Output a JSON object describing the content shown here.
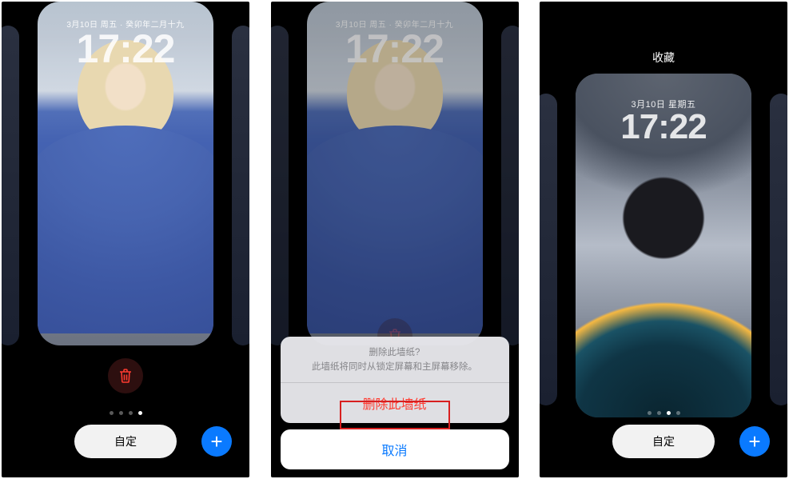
{
  "lock_screen": {
    "date_line": "3月10日 周五 · 癸卯年二月十九",
    "date_line_short": "3月10日 星期五",
    "time": "17:22"
  },
  "collections_label": "收藏",
  "trash_icon_name": "trash-icon",
  "page_dots": {
    "count": 4,
    "active_index_p1": 3,
    "active_index_p3": 2
  },
  "customize_label": "自定",
  "add_label": "+",
  "action_sheet": {
    "title": "删除此墙纸?",
    "message": "此墙纸将同时从锁定屏幕和主屏幕移除。",
    "destructive": "删除此墙纸",
    "cancel": "取消"
  },
  "colors": {
    "accent_blue": "#0a7aff",
    "destructive_red": "#ff3b30",
    "highlight_red": "#d81f1f"
  }
}
